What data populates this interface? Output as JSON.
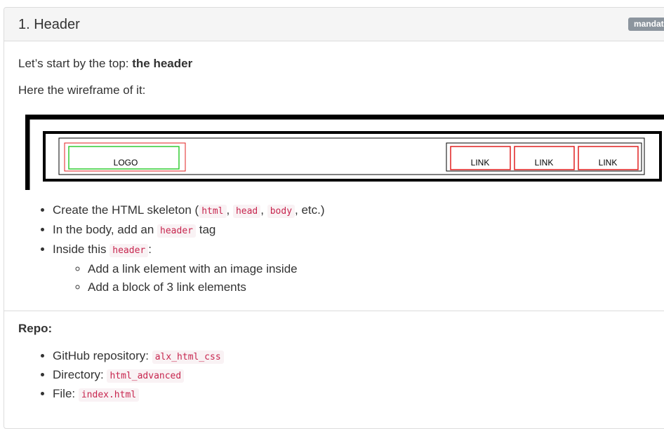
{
  "task": {
    "title": "1. Header",
    "badge": "mandatory"
  },
  "intro": {
    "prefix": "Let’s start by the top: ",
    "bold": "the header"
  },
  "wireframe_intro": "Here the wireframe of it:",
  "wireframe": {
    "logo_label": "LOGO",
    "link_labels": [
      "LINK",
      "LINK",
      "LINK"
    ]
  },
  "steps": {
    "s1_prefix": "Create the HTML skeleton (",
    "s1_codes": [
      "html",
      "head",
      "body"
    ],
    "s1_suffix": ", etc.)",
    "s2_prefix": "In the body, add an ",
    "s2_code": "header",
    "s2_suffix": " tag",
    "s3_prefix": "Inside this ",
    "s3_code": "header",
    "s3_suffix": ":",
    "sub": [
      "Add a link element with an image inside",
      "Add a block of 3 link elements"
    ]
  },
  "repo": {
    "title": "Repo:",
    "items": [
      {
        "label": "GitHub repository: ",
        "value": "alx_html_css"
      },
      {
        "label": "Directory: ",
        "value": "html_advanced"
      },
      {
        "label": "File: ",
        "value": "index.html"
      }
    ]
  },
  "colors": {
    "logo_inner": "#33cc33",
    "logo_outer": "#e02020",
    "link_border": "#e02020",
    "badge": "#8c959e",
    "code_text": "#c7254e",
    "code_bg": "#f9f2f4"
  }
}
